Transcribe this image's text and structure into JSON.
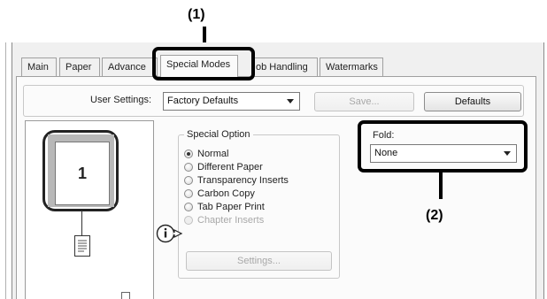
{
  "callouts": {
    "c1": "(1)",
    "c2": "(2)"
  },
  "tabs": [
    {
      "label": "Main"
    },
    {
      "label": "Paper"
    },
    {
      "label": "Advance"
    },
    {
      "label": "Special Modes"
    },
    {
      "label": "ob Handling"
    },
    {
      "label": "Watermarks"
    }
  ],
  "user_settings": {
    "label": "User Settings:",
    "value": "Factory Defaults",
    "save_label": "Save...",
    "defaults_label": "Defaults"
  },
  "preview": {
    "page_number": "1"
  },
  "special_option": {
    "title": "Special Option",
    "options": [
      {
        "label": "Normal",
        "checked": true,
        "enabled": true
      },
      {
        "label": "Different Paper",
        "checked": false,
        "enabled": true
      },
      {
        "label": "Transparency Inserts",
        "checked": false,
        "enabled": true
      },
      {
        "label": "Carbon Copy",
        "checked": false,
        "enabled": true
      },
      {
        "label": "Tab Paper Print",
        "checked": false,
        "enabled": true
      },
      {
        "label": "Chapter Inserts",
        "checked": false,
        "enabled": false
      }
    ],
    "settings_label": "Settings..."
  },
  "fold": {
    "label": "Fold:",
    "value": "None"
  }
}
